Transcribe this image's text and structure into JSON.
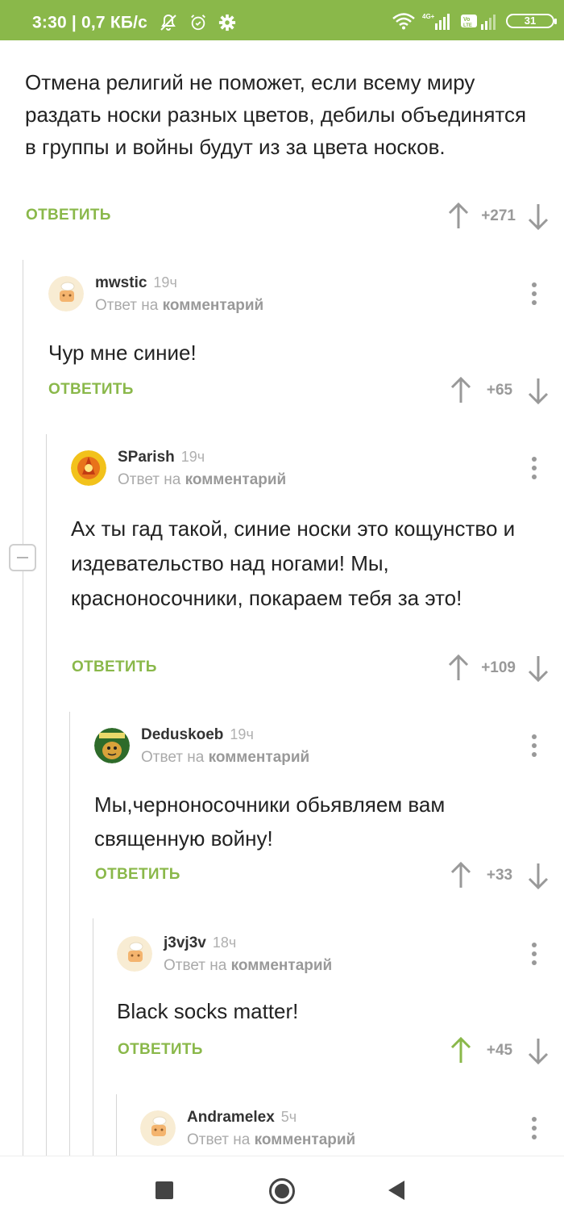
{
  "status_bar": {
    "time": "3:30",
    "speed": "0,7 КБ/с",
    "battery": "31",
    "network": "4G+",
    "volte": "Vo LTE"
  },
  "root_comment": {
    "text": "Отмена религий не поможет, если всему миру раздать носки разных цветов, дебилы объединятся в группы и войны будут из за цвета носков.",
    "reply_label": "ОТВЕТИТЬ",
    "score": "+271"
  },
  "comments": [
    {
      "username": "mwstic",
      "time": "19ч",
      "reply_prefix": "Ответ на",
      "reply_target": "комментарий",
      "text": "Чур мне синие!",
      "reply_label": "ОТВЕТИТЬ",
      "score": "+65",
      "upvoted": false
    },
    {
      "username": "SParish",
      "time": "19ч",
      "reply_prefix": "Ответ на",
      "reply_target": "комментарий",
      "text": "Ах ты гад такой, синие носки это кощунство и издевательство над ногами! Мы, красноносочники, покараем тебя за это!",
      "reply_label": "ОТВЕТИТЬ",
      "score": "+109",
      "upvoted": false
    },
    {
      "username": "Deduskoeb",
      "time": "19ч",
      "reply_prefix": "Ответ на",
      "reply_target": "комментарий",
      "text": "Мы,черноносочники обьявляем вам священную войну!",
      "reply_label": "ОТВЕТИТЬ",
      "score": "+33",
      "upvoted": false
    },
    {
      "username": "j3vj3v",
      "time": "18ч",
      "reply_prefix": "Ответ на",
      "reply_target": "комментарий",
      "text": "Black socks matter!",
      "reply_label": "ОТВЕТИТЬ",
      "score": "+45",
      "upvoted": true
    },
    {
      "username": "Andramelex",
      "time": "5ч",
      "reply_prefix": "Ответ на",
      "reply_target": "комментарий",
      "text": "",
      "reply_label": "",
      "score": "",
      "upvoted": false
    }
  ],
  "colors": {
    "accent": "#8ab84a",
    "status_bar": "#8ab84a",
    "muted": "#999999",
    "text": "#222222"
  },
  "nav": {
    "icons": [
      "recents-square-icon",
      "home-circle-icon",
      "back-triangle-icon"
    ]
  }
}
